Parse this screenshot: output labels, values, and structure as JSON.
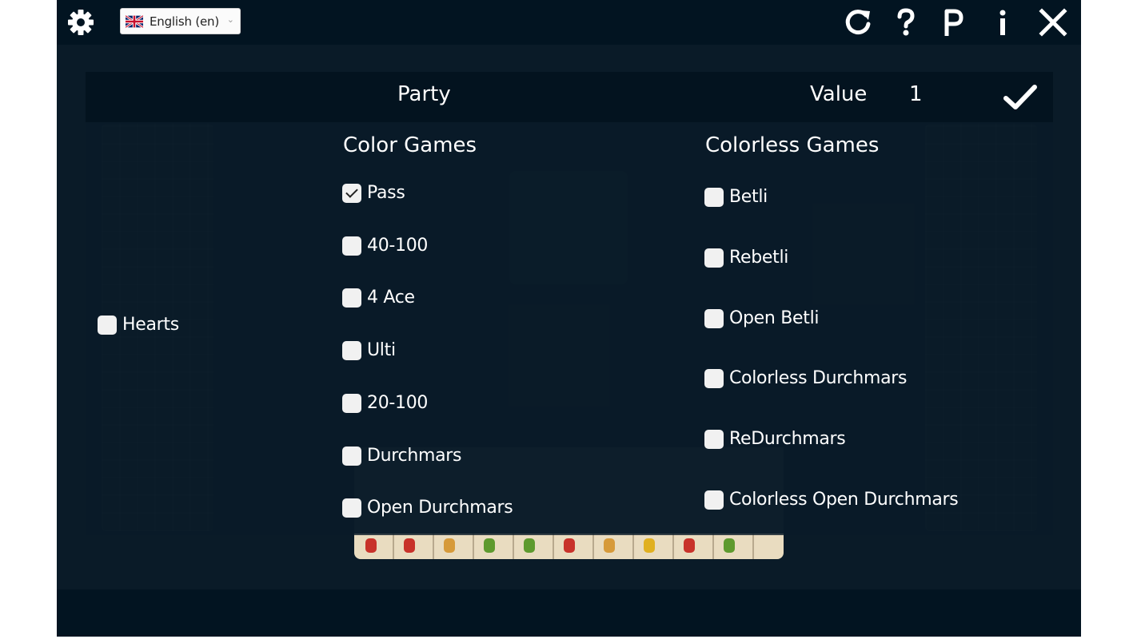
{
  "topbar": {
    "language": "English (en)",
    "icons": [
      "gear-icon",
      "uk-flag-icon",
      "reload-icon",
      "help-icon",
      "park-icon",
      "info-icon",
      "close-icon"
    ]
  },
  "header": {
    "party_label": "Party",
    "value_label": "Value",
    "value": "1"
  },
  "trump": {
    "label": "Hearts",
    "checked": false
  },
  "color_games": {
    "title": "Color Games",
    "items": [
      {
        "label": "Pass",
        "checked": true
      },
      {
        "label": "40-100",
        "checked": false
      },
      {
        "label": "4 Ace",
        "checked": false
      },
      {
        "label": "Ulti",
        "checked": false
      },
      {
        "label": "20-100",
        "checked": false
      },
      {
        "label": "Durchmars",
        "checked": false
      },
      {
        "label": "Open Durchmars",
        "checked": false
      }
    ]
  },
  "colorless_games": {
    "title": "Colorless Games",
    "items": [
      {
        "label": "Betli",
        "checked": false
      },
      {
        "label": "Rebetli",
        "checked": false
      },
      {
        "label": "Open Betli",
        "checked": false
      },
      {
        "label": "Colorless Durchmars",
        "checked": false
      },
      {
        "label": "ReDurchmars",
        "checked": false
      },
      {
        "label": "Colorless Open Durchmars",
        "checked": false
      }
    ]
  },
  "colors": {
    "background": "#0a1b28",
    "bar": "#021421",
    "text": "#ffffff",
    "checkbox": "#f1f1f1"
  }
}
